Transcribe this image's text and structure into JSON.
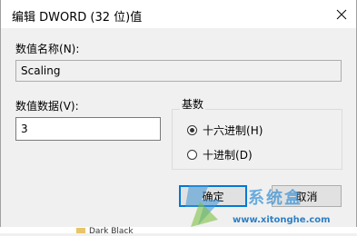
{
  "window": {
    "title": "编辑 DWORD (32 位)值",
    "close_glyph": "✕"
  },
  "value_name": {
    "label": "数值名称",
    "mnemonic": "(N):",
    "value": "Scaling"
  },
  "value_data": {
    "label": "数值数据",
    "mnemonic": "(V):",
    "value": "3"
  },
  "base": {
    "label": "基数",
    "options": [
      {
        "label": "十六进制",
        "mnemonic": "(H)",
        "checked": true
      },
      {
        "label": "十进制",
        "mnemonic": "(D)",
        "checked": false
      }
    ]
  },
  "buttons": {
    "ok": "确定",
    "cancel": "取消"
  },
  "watermark": {
    "text": "系统盒",
    "url": "www.xitonghe.com",
    "colors": {
      "blue": "#3d93d6",
      "green": "#7dc243"
    }
  },
  "background_app": {
    "item_text": "Dark Black",
    "folder_color": "#e8c56a"
  },
  "colors": {
    "accent": "#0078d7",
    "window_bg": "#f0f0f0",
    "titlebar_bg": "#ffffff"
  }
}
